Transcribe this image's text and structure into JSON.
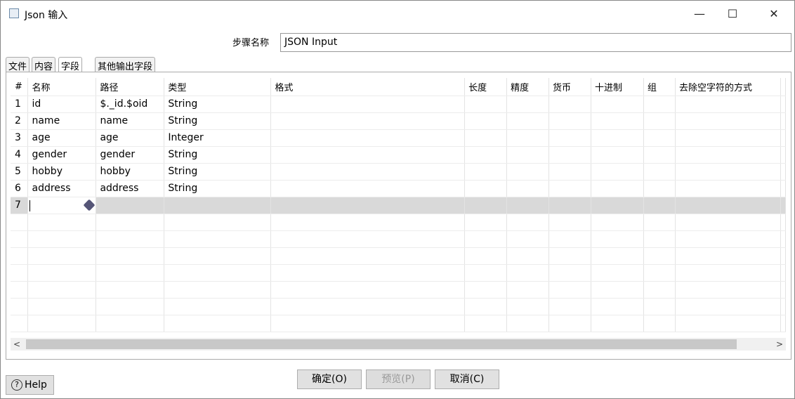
{
  "window": {
    "title": "Json 输入",
    "minimize": "—",
    "maximize": "☐",
    "close": "✕"
  },
  "step": {
    "label": "步骤名称",
    "value": "JSON Input"
  },
  "tabs": [
    "文件",
    "内容",
    "字段",
    "其他输出字段"
  ],
  "table": {
    "headers": [
      "#",
      "名称",
      "路径",
      "类型",
      "格式",
      "长度",
      "精度",
      "货币",
      "十进制",
      "组",
      "去除空字符的方式"
    ],
    "rows": [
      [
        "1",
        "id",
        "$._id.$oid",
        "String"
      ],
      [
        "2",
        "name",
        "name",
        "String"
      ],
      [
        "3",
        "age",
        "age",
        "Integer"
      ],
      [
        "4",
        "gender",
        "gender",
        "String"
      ],
      [
        "5",
        "hobby",
        "hobby",
        "String"
      ],
      [
        "6",
        "address",
        "address",
        "String"
      ],
      [
        "7",
        "",
        "",
        ""
      ]
    ]
  },
  "buttons": {
    "ok": "确定(O)",
    "preview": "预览(P)",
    "cancel": "取消(C)",
    "help": "Help",
    "help_icon": "?"
  }
}
